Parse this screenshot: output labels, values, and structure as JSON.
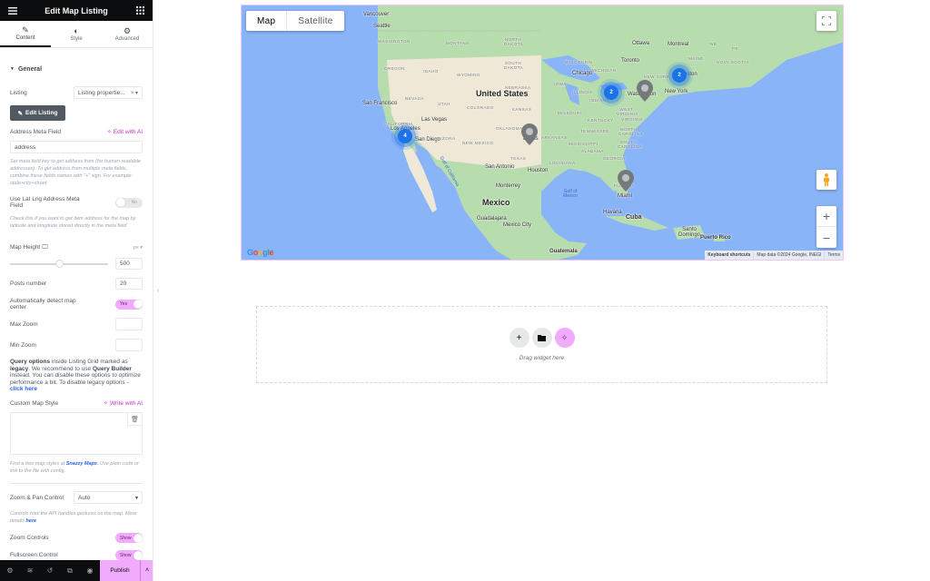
{
  "panel": {
    "title": "Edit Map Listing",
    "tabs": [
      {
        "label": "Content",
        "icon": "pencil-icon",
        "active": true
      },
      {
        "label": "Style",
        "icon": "contrast-icon",
        "active": false
      },
      {
        "label": "Advanced",
        "icon": "gear-icon",
        "active": false
      }
    ],
    "section": "General",
    "listing": {
      "label": "Listing",
      "value": "Listing propertie..."
    },
    "edit_listing_button": "Edit Listing",
    "address_meta": {
      "label": "Address Meta Field",
      "ai_label": "Edit with AI",
      "value": "address",
      "help": "Set meta field key to get address from (for human-readable addresses). To get address from multiple meta fields, combine these fields names with \"+\" sign. For example: state+city+street"
    },
    "lat_lng": {
      "label": "Use Lat Lng Address Meta Field",
      "toggle": "No",
      "help": "Check this if you want to get item address for the map by latitude and longitude stored directly in the meta field"
    },
    "map_height": {
      "label": "Map Height",
      "unit": "px",
      "value": "500",
      "slider_fraction": 0.5
    },
    "posts_number": {
      "label": "Posts number",
      "value": "20"
    },
    "auto_center": {
      "label": "Automatically detect map center",
      "toggle": "Yes"
    },
    "max_zoom": {
      "label": "Max Zoom",
      "value": ""
    },
    "min_zoom": {
      "label": "Min Zoom",
      "value": ""
    },
    "legacy": {
      "b1": "Query options",
      "t1": " inside Listing Grid marked as ",
      "b2": "legacy",
      "t2": ". We recommend to use ",
      "b3": "Query Builder",
      "t3": " instead. You can disable these options to optimize performance a bit. To disable legacy options - ",
      "link": "click here"
    },
    "custom_style": {
      "label": "Custom Map Style",
      "ai_label": "Write with AI",
      "help_pre": "Find a free map styles at ",
      "help_link": "Snazzy Maps",
      "help_post": ". Use plain code or link to the file with config."
    },
    "zoom_pan": {
      "label": "Zoom & Pan Control",
      "value": "Auto",
      "help_pre": "Controls how the API handles gestures on the map. More details ",
      "help_link": "here"
    },
    "zoom_controls": {
      "label": "Zoom Controls",
      "toggle": "Show"
    },
    "fullscreen_control": {
      "label": "Fullscreen Control",
      "toggle": "Show"
    },
    "footer": {
      "publish": "Publish"
    }
  },
  "map": {
    "type_buttons": [
      "Map",
      "Satellite"
    ],
    "selected_type": "Map",
    "labels": {
      "countries": [
        "United States",
        "Mexico",
        "Cuba"
      ],
      "cities": [
        "Vancouver",
        "Seattle",
        "San Francisco",
        "Las Vegas",
        "Los Angeles",
        "San Diego",
        "Dallas",
        "San Antonio",
        "Houston",
        "Monterrey",
        "Guadalajara",
        "Mexico City",
        "Chicago",
        "Toronto",
        "Ottawa",
        "Montreal",
        "Boston",
        "New York",
        "Washington",
        "Miami",
        "Havana",
        "Santo Domingo",
        "Puerto Rico",
        "Guatemala"
      ],
      "states": [
        "WASHINGTON",
        "OREGON",
        "IDAHO",
        "MONTANA",
        "WYOMING",
        "NEVADA",
        "UTAH",
        "COLORADO",
        "CALIFORNIA",
        "ARIZONA",
        "NEW MEXICO",
        "TEXAS",
        "KANSAS",
        "NEBRASKA",
        "NORTH DAKOTA",
        "SOUTH DAKOTA",
        "IOWA",
        "ILLINOIS",
        "INDIANA",
        "MISSOURI",
        "WISCONSIN",
        "MICHIGAN",
        "KENTUCKY",
        "TENNESSEE",
        "ARKANSAS",
        "MISSISSIPPI",
        "ALABAMA",
        "GEORGIA",
        "LOUISIANA",
        "WEST VIRGINIA",
        "VIRGINIA",
        "NORTH CAROLINA",
        "SOUTH CAROLINA",
        "NEW YORK",
        "MAINE",
        "NOVA SCOTIA",
        "NB",
        "PE",
        "OKLAHOMA",
        "FLORIDA"
      ],
      "water": [
        "Gulf of California",
        "Gulf of Mexico"
      ]
    },
    "clusters": [
      {
        "count": "4",
        "near": "Los Angeles"
      },
      {
        "count": "2",
        "near": "Indiana/Ohio"
      },
      {
        "count": "2",
        "near": "Boston"
      }
    ],
    "pins": [
      "Dallas",
      "Washington",
      "Miami"
    ],
    "attribution": {
      "keyboard": "Keyboard shortcuts",
      "data": "Map data ©2024 Google, INEGI",
      "terms": "Terms"
    },
    "logo": "Google"
  },
  "dropzone": {
    "text": "Drag widget here"
  }
}
